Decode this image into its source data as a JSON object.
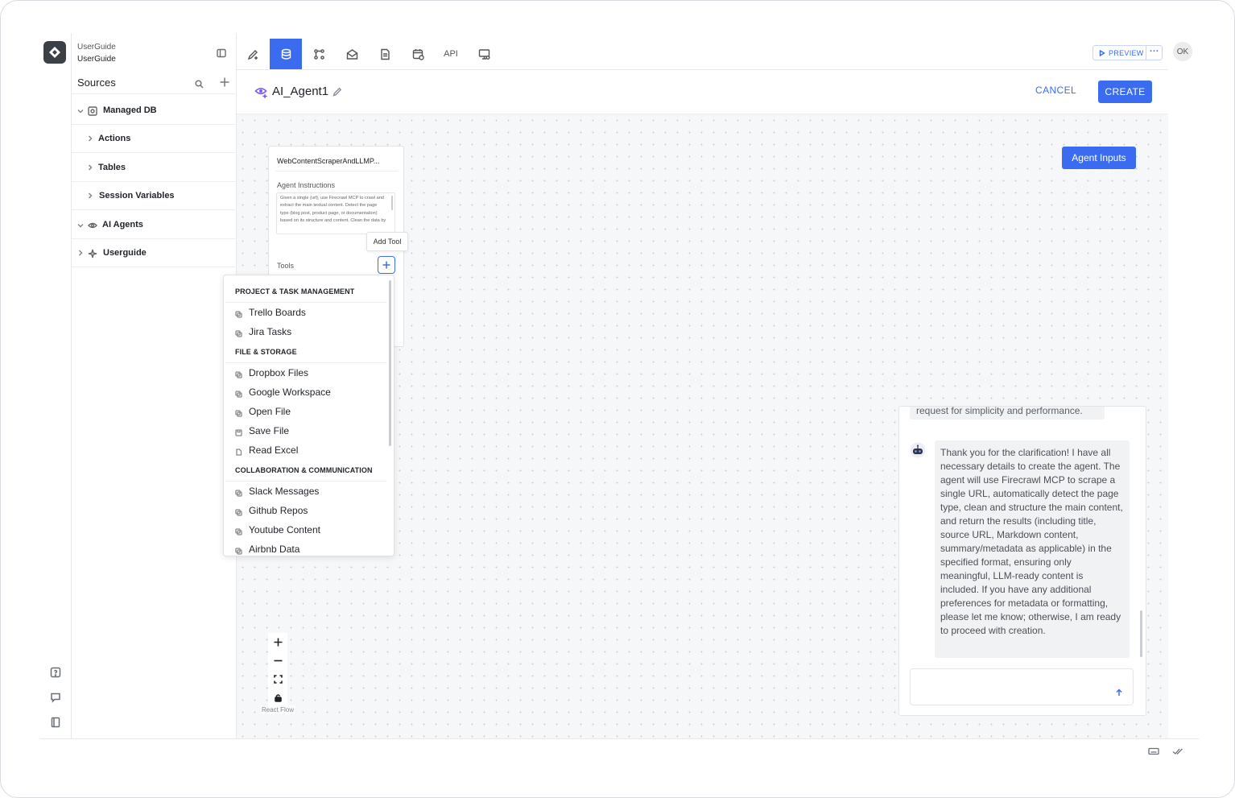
{
  "brand": {
    "line1": "UserGuide",
    "line2": "UserGuide"
  },
  "sidebar": {
    "title": "Sources",
    "items": [
      {
        "label": "Managed DB",
        "level": 0,
        "expanded": true,
        "icon": "database-icon"
      },
      {
        "label": "Actions",
        "level": 1,
        "expanded": false
      },
      {
        "label": "Tables",
        "level": 1,
        "expanded": false
      },
      {
        "label": "Session Variables",
        "level": 1,
        "expanded": false
      },
      {
        "label": "AI Agents",
        "level": 0,
        "expanded": true,
        "icon": "eye-icon"
      },
      {
        "label": "Userguide",
        "level": 0,
        "expanded": false,
        "icon": "sparkle-icon"
      }
    ]
  },
  "toolbar": {
    "api_label": "API",
    "preview_label": "PREVIEW",
    "more_label": "···",
    "active_tab": "database",
    "avatar_initials": "OK"
  },
  "editor": {
    "agent_name": "AI_Agent1",
    "cancel_label": "CANCEL",
    "create_label": "CREATE",
    "agent_inputs_label": "Agent Inputs"
  },
  "node": {
    "title": "WebContentScraperAndLLMP...",
    "instructions_label": "Agent Instructions",
    "instructions_text": "Given a single {url}, use Firecrawl MCP to crawl and extract the main textual content. Detect the page type (blog post, product page, or documentation) based on its structure and content. Clean the data by",
    "tools_label": "Tools",
    "add_tool_tooltip": "Add Tool"
  },
  "tool_menu": {
    "groups": [
      {
        "heading": "PROJECT & TASK MANAGEMENT",
        "items": [
          "Trello Boards",
          "Jira Tasks"
        ]
      },
      {
        "heading": "FILE & STORAGE",
        "items": [
          "Dropbox Files",
          "Google Workspace",
          "Open File",
          "Save File",
          "Read Excel"
        ]
      },
      {
        "heading": "COLLABORATION & COMMUNICATION",
        "items": [
          "Slack Messages",
          "Github Repos",
          "Youtube Content",
          "Airbnb Data"
        ]
      }
    ]
  },
  "canvas": {
    "attribution": "React Flow"
  },
  "chat": {
    "previous_fragment": "request for simplicity and performance.",
    "assistant_message": "Thank you for the clarification! I have all necessary details to create the agent. The agent will use Firecrawl MCP to scrape a single URL, automatically detect the page type, clean and structure the main content, and return the results (including title, source URL, Markdown content, summary/metadata as applicable) in the specified format, ensuring only meaningful, LLM-ready content is included. If you have any additional preferences for metadata or formatting, please let me know; otherwise, I am ready to proceed with creation.",
    "input_value": ""
  },
  "colors": {
    "accent": "#3b6cf0",
    "canvas_bg": "#f6f7f9"
  }
}
